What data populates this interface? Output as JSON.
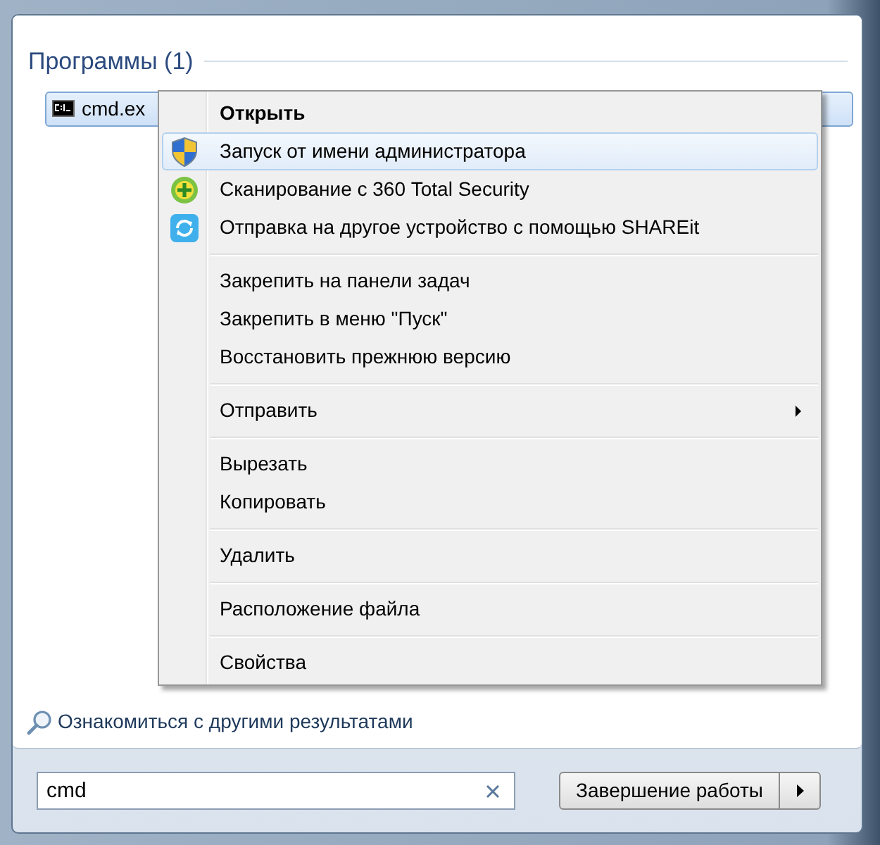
{
  "programs": {
    "heading": "Программы (1)",
    "items": [
      {
        "label": "cmd.ex",
        "selected": true
      }
    ]
  },
  "context_menu": {
    "groups": [
      {
        "items": [
          {
            "label": "Открыть",
            "default": true,
            "selected": false,
            "submenu": false
          },
          {
            "label": "Запуск от имени администратора",
            "default": false,
            "selected": true,
            "submenu": false
          },
          {
            "label": "Сканирование с 360 Total Security",
            "default": false,
            "selected": false,
            "submenu": false
          },
          {
            "label": "Отправка на другое устройство с помощью SHAREit",
            "default": false,
            "selected": false,
            "submenu": false
          }
        ]
      },
      {
        "items": [
          {
            "label": "Закрепить на панели задач",
            "default": false,
            "selected": false,
            "submenu": false
          },
          {
            "label": "Закрепить в меню \"Пуск\"",
            "default": false,
            "selected": false,
            "submenu": false
          },
          {
            "label": "Восстановить прежнюю версию",
            "default": false,
            "selected": false,
            "submenu": false
          }
        ]
      },
      {
        "items": [
          {
            "label": "Отправить",
            "default": false,
            "selected": false,
            "submenu": true
          }
        ]
      },
      {
        "items": [
          {
            "label": "Вырезать",
            "default": false,
            "selected": false,
            "submenu": false
          },
          {
            "label": "Копировать",
            "default": false,
            "selected": false,
            "submenu": false
          }
        ]
      },
      {
        "items": [
          {
            "label": "Удалить",
            "default": false,
            "selected": false,
            "submenu": false
          }
        ]
      },
      {
        "items": [
          {
            "label": "Расположение файла",
            "default": false,
            "selected": false,
            "submenu": false
          }
        ]
      },
      {
        "items": [
          {
            "label": "Свойства",
            "default": false,
            "selected": false,
            "submenu": false
          }
        ]
      }
    ]
  },
  "more_results_link": "Ознакомиться с другими результатами",
  "search": {
    "value": "cmd"
  },
  "shutdown_button": {
    "label": "Завершение работы"
  }
}
